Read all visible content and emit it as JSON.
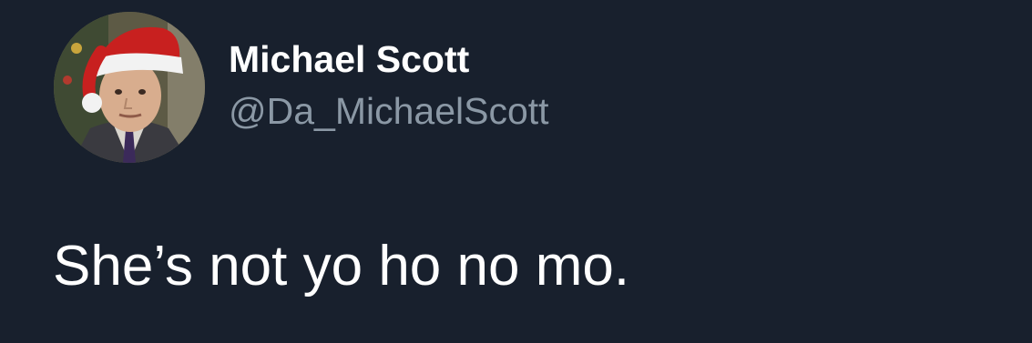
{
  "tweet": {
    "author": {
      "display_name": "Michael Scott",
      "handle": "@Da_MichaelScott"
    },
    "text": "She’s not yo ho no mo."
  },
  "colors": {
    "background": "#18202d",
    "name": "#ffffff",
    "handle": "#8b98a5",
    "text": "#ffffff"
  }
}
